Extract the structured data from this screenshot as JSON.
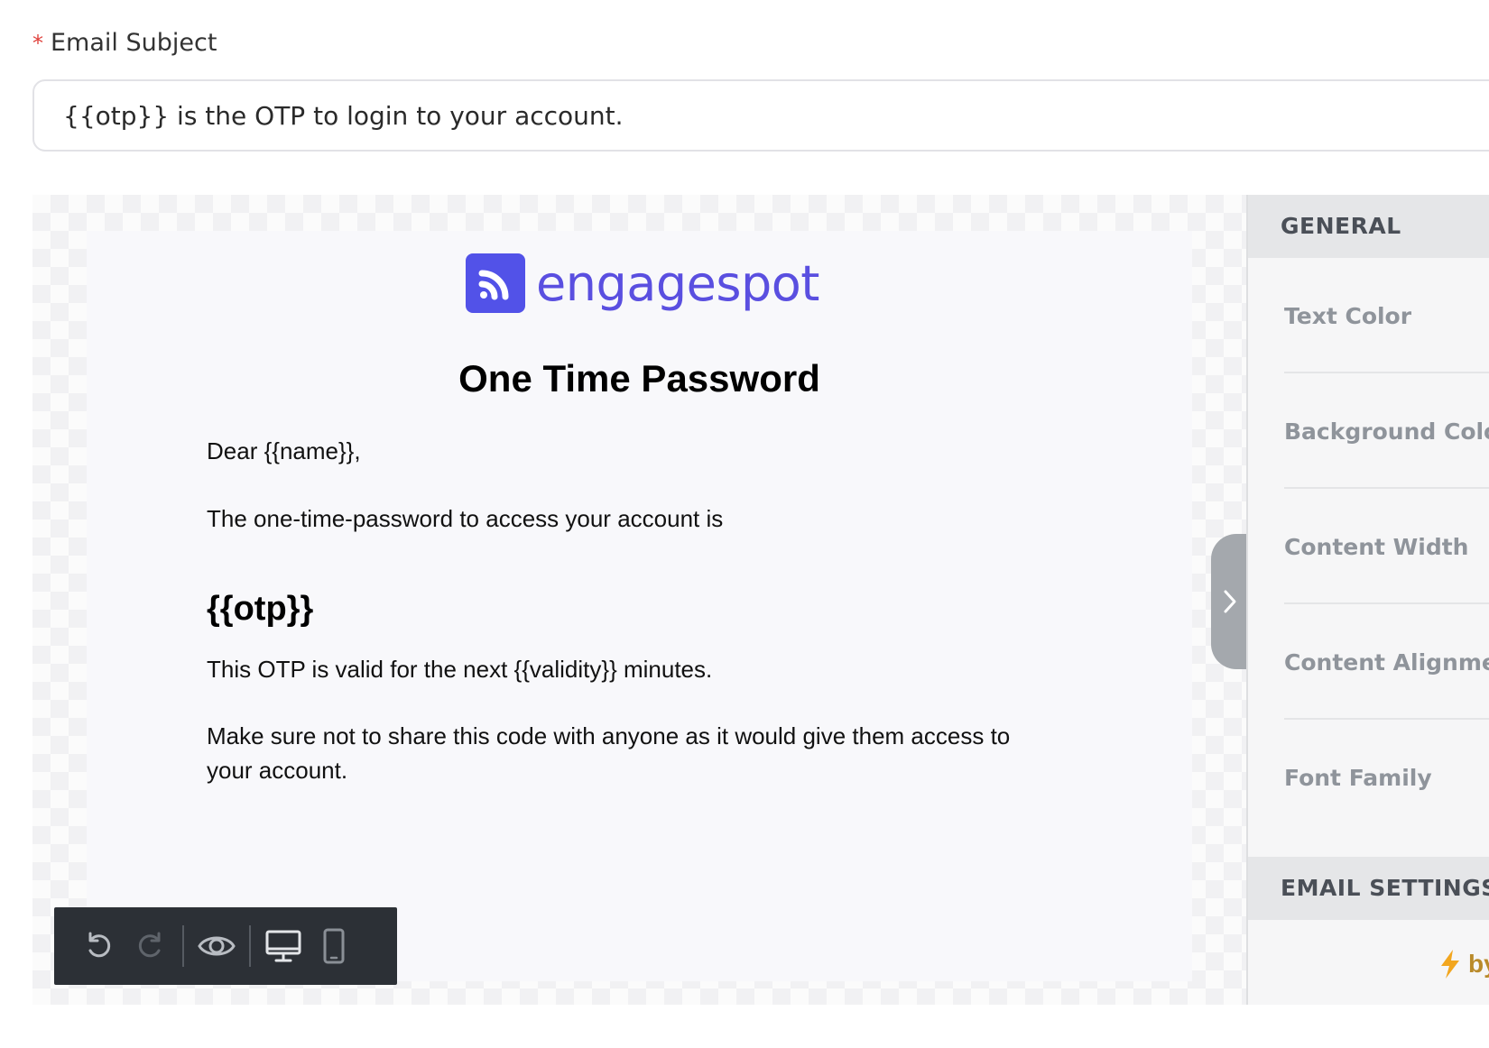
{
  "subject": {
    "required_marker": "*",
    "label": "Email Subject",
    "value": "{{otp}} is the OTP to login to your account."
  },
  "email": {
    "logo_text": "engagespot",
    "title": "One Time Password",
    "greeting": "Dear {{name}},",
    "intro": "The one-time-password to access your account is",
    "otp": "{{otp}}",
    "validity": "This OTP is valid for the next {{validity}} minutes.",
    "warning_line1": "Make sure not to share this code with anyone as it would give them access to",
    "warning_line2": "your account."
  },
  "toolbar": {
    "icons": [
      "undo-icon",
      "redo-icon",
      "eye-icon",
      "desktop-icon",
      "mobile-icon"
    ]
  },
  "panel": {
    "general_header": "GENERAL",
    "rows": [
      "Text Color",
      "Background Color",
      "Content Width",
      "Content Alignment",
      "Font Family"
    ],
    "email_settings_header": "EMAIL SETTINGS",
    "powered_text": "by"
  },
  "colors": {
    "brand": "#5252e8",
    "required": "#e0413c",
    "toolbar_bg": "#2c3036"
  }
}
